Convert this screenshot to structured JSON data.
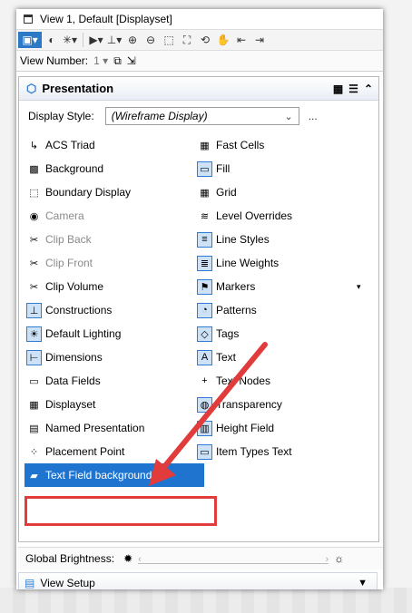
{
  "window": {
    "title": "View 1, Default [Displayset]"
  },
  "viewbar": {
    "label": "View Number:",
    "value": "1"
  },
  "panel": {
    "title": "Presentation",
    "display_style_label": "Display Style:",
    "display_style_value": "(Wireframe Display)",
    "more": "..."
  },
  "left_items": [
    {
      "label": "ACS Triad",
      "icon": "acs-triad-icon",
      "state": "off"
    },
    {
      "label": "Background",
      "icon": "background-icon",
      "state": "off"
    },
    {
      "label": "Boundary Display",
      "icon": "boundary-display-icon",
      "state": "off"
    },
    {
      "label": "Camera",
      "icon": "camera-icon",
      "state": "disabled"
    },
    {
      "label": "Clip Back",
      "icon": "clip-back-icon",
      "state": "disabled"
    },
    {
      "label": "Clip Front",
      "icon": "clip-front-icon",
      "state": "disabled"
    },
    {
      "label": "Clip Volume",
      "icon": "clip-volume-icon",
      "state": "off"
    },
    {
      "label": "Constructions",
      "icon": "constructions-icon",
      "state": "on"
    },
    {
      "label": "Default Lighting",
      "icon": "default-lighting-icon",
      "state": "on"
    },
    {
      "label": "Dimensions",
      "icon": "dimensions-icon",
      "state": "on"
    },
    {
      "label": "Data Fields",
      "icon": "data-fields-icon",
      "state": "off"
    },
    {
      "label": "Displayset",
      "icon": "displayset-icon",
      "state": "off"
    },
    {
      "label": "Named Presentation",
      "icon": "named-presentation-icon",
      "state": "off"
    },
    {
      "label": "Placement Point",
      "icon": "placement-point-icon",
      "state": "off"
    },
    {
      "label": "Text Field background",
      "icon": "text-field-background-icon",
      "state": "selected"
    }
  ],
  "right_items": [
    {
      "label": "Fast Cells",
      "icon": "fast-cells-icon",
      "state": "off"
    },
    {
      "label": "Fill",
      "icon": "fill-icon",
      "state": "on"
    },
    {
      "label": "Grid",
      "icon": "grid-icon",
      "state": "off"
    },
    {
      "label": "Level Overrides",
      "icon": "level-overrides-icon",
      "state": "off"
    },
    {
      "label": "Line Styles",
      "icon": "line-styles-icon",
      "state": "on"
    },
    {
      "label": "Line Weights",
      "icon": "line-weights-icon",
      "state": "on"
    },
    {
      "label": "Markers",
      "icon": "markers-icon",
      "state": "on"
    },
    {
      "label": "Patterns",
      "icon": "patterns-icon",
      "state": "on"
    },
    {
      "label": "Tags",
      "icon": "tags-icon",
      "state": "on"
    },
    {
      "label": "Text",
      "icon": "text-icon",
      "state": "on"
    },
    {
      "label": "Text Nodes",
      "icon": "text-nodes-icon",
      "state": "off"
    },
    {
      "label": "Transparency",
      "icon": "transparency-icon",
      "state": "on"
    },
    {
      "label": "Height Field",
      "icon": "height-field-icon",
      "state": "on"
    },
    {
      "label": "Item Types Text",
      "icon": "item-types-text-icon",
      "state": "on"
    }
  ],
  "brightness": {
    "label": "Global Brightness:"
  },
  "view_setup": {
    "label": "View Setup"
  },
  "colors": {
    "accent": "#1f74d0",
    "highlight": "#e23b3b"
  }
}
